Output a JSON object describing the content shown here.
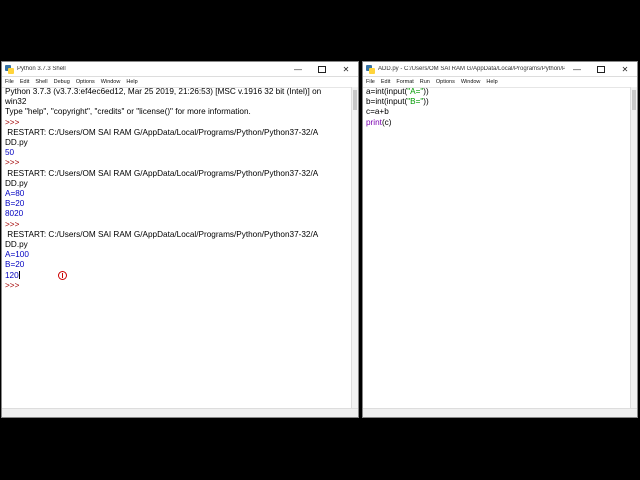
{
  "shell": {
    "title": "Python 3.7.3 Shell",
    "menu": [
      "File",
      "Edit",
      "Shell",
      "Debug",
      "Options",
      "Window",
      "Help"
    ],
    "lines": [
      {
        "text": "Python 3.7.3 (v3.7.3:ef4ec6ed12, Mar 25 2019, 21:26:53) [MSC v.1916 32 bit (Intel)] on",
        "style": "dflt"
      },
      {
        "text": "win32",
        "style": "dflt"
      },
      {
        "text": "Type \"help\", \"copyright\", \"credits\" or \"license()\" for more information.",
        "style": "dflt"
      },
      {
        "text": ">>> ",
        "style": "prompt"
      },
      {
        "text": " RESTART: C:/Users/OM SAI RAM G/AppData/Local/Programs/Python/Python37-32/A",
        "style": "dflt"
      },
      {
        "text": "DD.py",
        "style": "dflt"
      },
      {
        "text": "50",
        "style": "out"
      },
      {
        "text": ">>> ",
        "style": "prompt"
      },
      {
        "text": " RESTART: C:/Users/OM SAI RAM G/AppData/Local/Programs/Python/Python37-32/A",
        "style": "dflt"
      },
      {
        "text": "DD.py",
        "style": "dflt"
      },
      {
        "text": "A=80",
        "style": "out"
      },
      {
        "text": "B=20",
        "style": "out"
      },
      {
        "text": "8020",
        "style": "out"
      },
      {
        "text": ">>> ",
        "style": "prompt"
      },
      {
        "text": " RESTART: C:/Users/OM SAI RAM G/AppData/Local/Programs/Python/Python37-32/A",
        "style": "dflt"
      },
      {
        "text": "DD.py",
        "style": "dflt"
      },
      {
        "text": "A=100",
        "style": "out"
      },
      {
        "text": "B=20",
        "style": "out"
      },
      {
        "text": "120",
        "style": "out"
      },
      {
        "text": ">>> ",
        "style": "prompt"
      }
    ]
  },
  "editor": {
    "title": "ADD.py - C:/Users/OM SAI RAM G/AppData/Local/Programs/Python/Python...",
    "menu": [
      "File",
      "Edit",
      "Format",
      "Run",
      "Options",
      "Window",
      "Help"
    ],
    "code": [
      [
        {
          "t": "a=int(input(",
          "c": "inp"
        },
        {
          "t": "\"A=\"",
          "c": "str"
        },
        {
          "t": "))",
          "c": "inp"
        }
      ],
      [
        {
          "t": "b=int(input(",
          "c": "inp"
        },
        {
          "t": "\"B=\"",
          "c": "str"
        },
        {
          "t": "))",
          "c": "inp"
        }
      ],
      [
        {
          "t": "c=a+b",
          "c": "inp"
        }
      ],
      [
        {
          "t": "print",
          "c": "kw"
        },
        {
          "t": "(c)",
          "c": "inp"
        }
      ]
    ]
  },
  "window_controls": {
    "minimize": "—",
    "close": "✕"
  }
}
